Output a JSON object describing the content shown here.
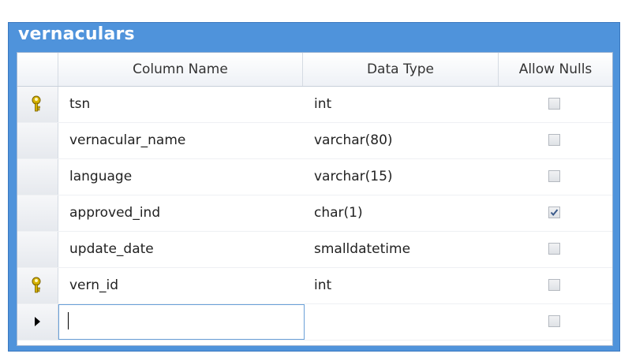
{
  "table": {
    "title": "vernaculars",
    "columns": [
      "Column Name",
      "Data Type",
      "Allow Nulls"
    ],
    "rows": [
      {
        "name": "tsn",
        "type": "int",
        "allow_nulls": false,
        "primary_key": true
      },
      {
        "name": "vernacular_name",
        "type": "varchar(80)",
        "allow_nulls": false,
        "primary_key": false
      },
      {
        "name": "language",
        "type": "varchar(15)",
        "allow_nulls": false,
        "primary_key": false
      },
      {
        "name": "approved_ind",
        "type": "char(1)",
        "allow_nulls": true,
        "primary_key": false
      },
      {
        "name": "update_date",
        "type": "smalldatetime",
        "allow_nulls": false,
        "primary_key": false
      },
      {
        "name": "vern_id",
        "type": "int",
        "allow_nulls": false,
        "primary_key": true
      }
    ],
    "new_row": {
      "name": "",
      "type": "",
      "allow_nulls": false
    }
  },
  "colors": {
    "title_bar": "#4f93db",
    "key_icon": "#d7b300",
    "check": "#3a5a8a"
  },
  "icons": {
    "primary_key": "key-icon",
    "current_row": "row-pointer-arrow-icon"
  }
}
